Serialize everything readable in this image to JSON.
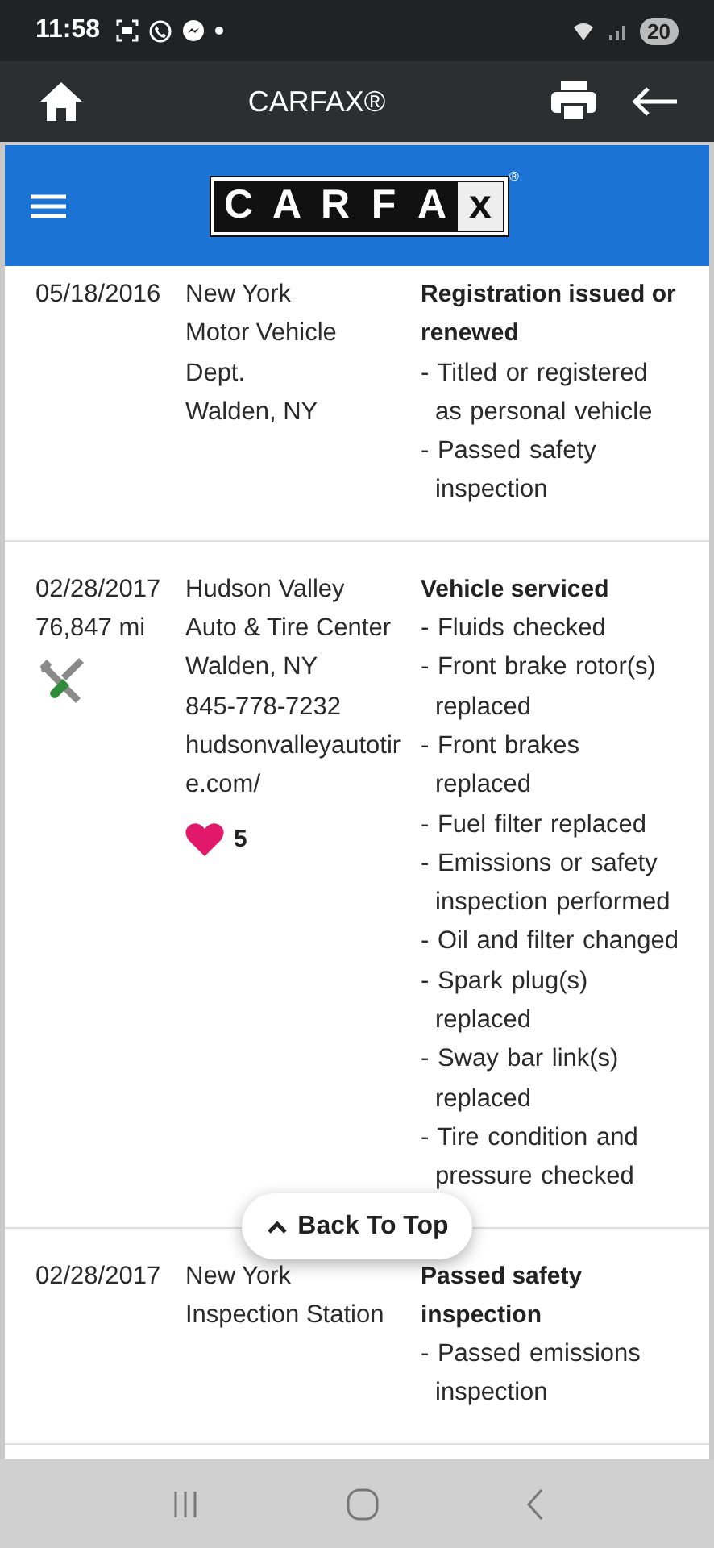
{
  "status_bar": {
    "time": "11:58",
    "battery": "20"
  },
  "app_bar": {
    "title": "CARFAX®"
  },
  "header": {
    "logo_letters": [
      "C",
      "A",
      "R",
      "F",
      "A",
      "x"
    ],
    "logo_mark": "®"
  },
  "records": [
    {
      "kind": "registration",
      "date": "05/18/2016",
      "source": [
        "New York",
        "Motor Vehicle",
        "Dept.",
        "Walden, NY"
      ],
      "title": "Registration issued or renewed",
      "items": [
        "- Titled or registered as personal vehicle",
        "- Passed safety inspection"
      ]
    },
    {
      "kind": "service",
      "date": "02/28/2017",
      "odometer": "76,847 mi",
      "source": [
        "Hudson Valley",
        "Auto & Tire Center",
        "Walden, NY",
        "845-778-7232"
      ],
      "website": "hudsonvalleyautotire.com/",
      "likes": "5",
      "title": "Vehicle serviced",
      "items": [
        "- Fluids checked",
        "- Front brake rotor(s) replaced",
        "- Front brakes replaced",
        "- Fuel filter replaced",
        "- Emissions or safety inspection performed",
        "- Oil and filter changed",
        "- Spark plug(s) replaced",
        "- Sway bar link(s) replaced",
        "- Tire condition and pressure checked"
      ]
    },
    {
      "kind": "inspection",
      "date": "02/28/2017",
      "source": [
        "New York",
        "Inspection Station"
      ],
      "title": "Passed safety inspection",
      "items": [
        "- Passed emissions inspection"
      ]
    }
  ],
  "back_to_top": {
    "label": "Back To Top"
  }
}
